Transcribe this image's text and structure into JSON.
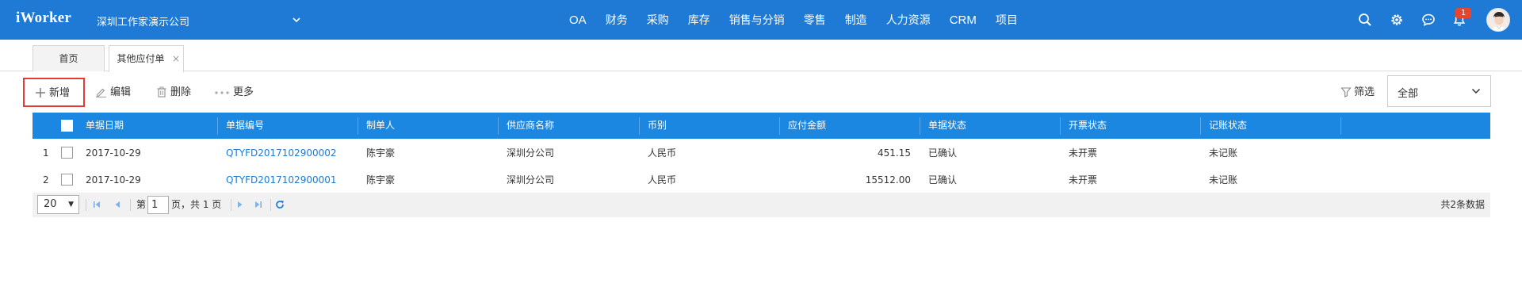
{
  "app": {
    "logo": "iWorker",
    "company": "深圳工作家演示公司"
  },
  "nav": {
    "items": [
      {
        "label": "OA"
      },
      {
        "label": "财务"
      },
      {
        "label": "采购"
      },
      {
        "label": "库存"
      },
      {
        "label": "销售与分销"
      },
      {
        "label": "零售"
      },
      {
        "label": "制造"
      },
      {
        "label": "人力资源"
      },
      {
        "label": "CRM"
      },
      {
        "label": "项目"
      }
    ],
    "icons": [
      "search-icon",
      "gear-icon",
      "chat-icon",
      "bell-icon"
    ],
    "notification_count": "1",
    "accent": "#1e7ad4"
  },
  "tabs": [
    {
      "label": "首页"
    },
    {
      "label": "其他应付单",
      "close": "×"
    }
  ],
  "toolbar": {
    "add": "新增",
    "edit": "编辑",
    "delete": "删除",
    "more": "更多",
    "filter": "筛选",
    "filter_value": "全部",
    "add_highlight": "#e53935"
  },
  "grid": {
    "header_color": "#1c87e0",
    "columns": [
      "单据日期",
      "单据编号",
      "制单人",
      "供应商名称",
      "币别",
      "应付金额",
      "单据状态",
      "开票状态",
      "记账状态"
    ],
    "rows": [
      {
        "index": "1",
        "date": "2017-10-29",
        "code": "QTYFD2017102900002",
        "maker": "陈宇豪",
        "supplier": "深圳分公司",
        "currency": "人民币",
        "amount": "451.15",
        "status": "已确认",
        "invoice": "未开票",
        "posting": "未记账"
      },
      {
        "index": "2",
        "date": "2017-10-29",
        "code": "QTYFD2017102900001",
        "maker": "陈宇豪",
        "supplier": "深圳分公司",
        "currency": "人民币",
        "amount": "15512.00",
        "status": "已确认",
        "invoice": "未开票",
        "posting": "未记账"
      }
    ]
  },
  "pager": {
    "page_size": "20",
    "page_prefix": "第",
    "page": "1",
    "page_suffix": "页，共 1 页",
    "total": "共2条数据"
  }
}
